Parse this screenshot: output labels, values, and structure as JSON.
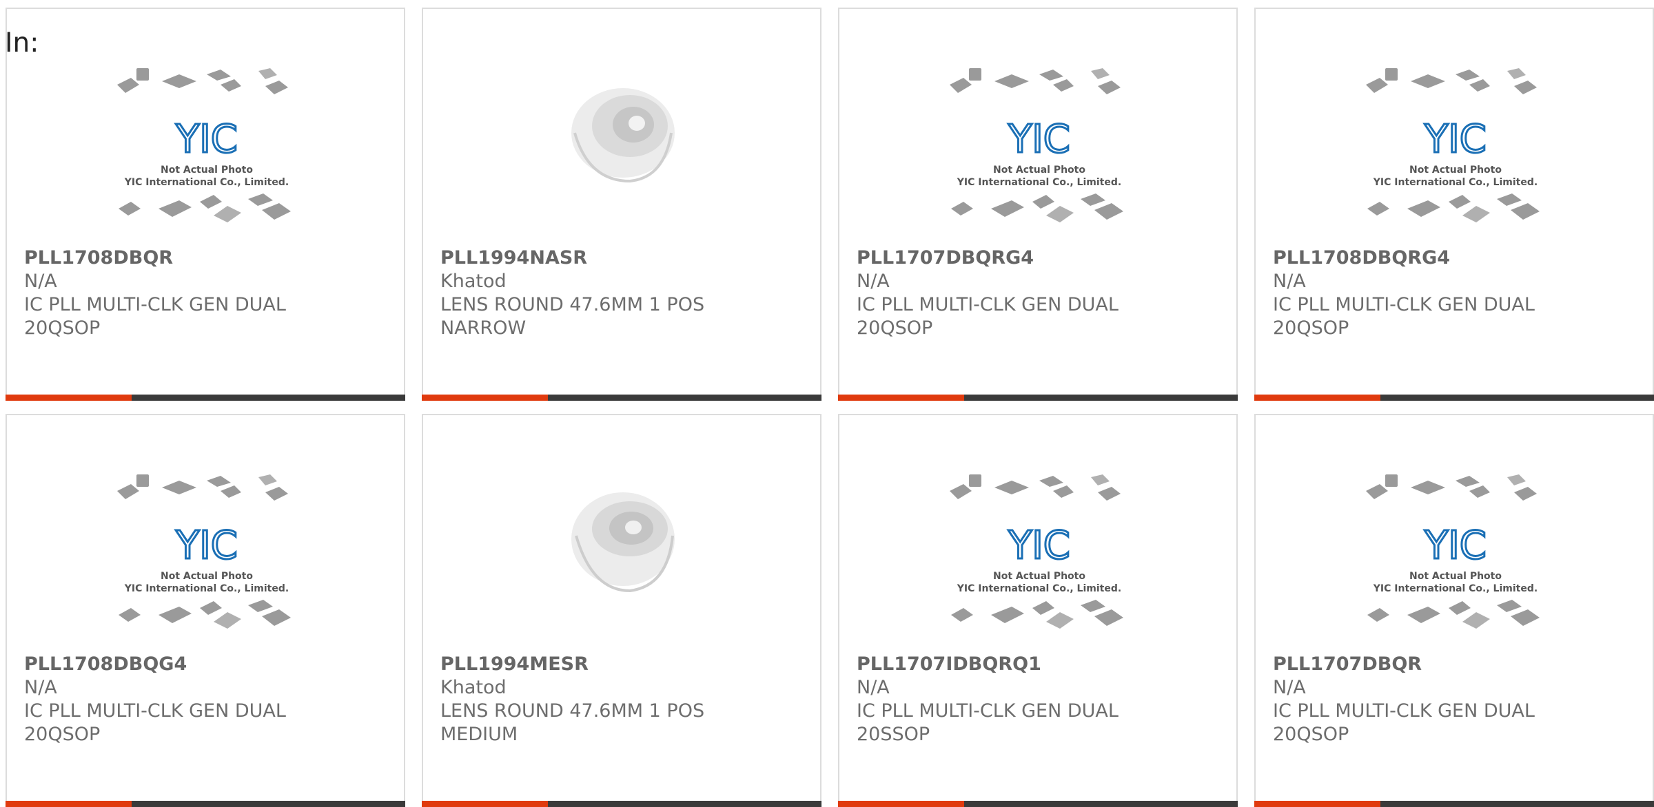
{
  "header": {
    "label": "In:"
  },
  "placeholder": {
    "line1": "Not Actual Photo",
    "line2": "YIC International Co., Limited."
  },
  "products": [
    {
      "part": "PLL1708DBQR",
      "mfr": "N/A",
      "desc": "IC PLL MULTI-CLK GEN DUAL 20QSOP",
      "image": "yic-placeholder"
    },
    {
      "part": "PLL1994NASR",
      "mfr": "Khatod",
      "desc": "LENS ROUND 47.6MM 1 POS NARROW",
      "image": "lens-photo"
    },
    {
      "part": "PLL1707DBQRG4",
      "mfr": "N/A",
      "desc": "IC PLL MULTI-CLK GEN DUAL 20QSOP",
      "image": "yic-placeholder"
    },
    {
      "part": "PLL1708DBQRG4",
      "mfr": "N/A",
      "desc": "IC PLL MULTI-CLK GEN DUAL 20QSOP",
      "image": "yic-placeholder"
    },
    {
      "part": "PLL1708DBQG4",
      "mfr": "N/A",
      "desc": "IC PLL MULTI-CLK GEN DUAL 20QSOP",
      "image": "yic-placeholder"
    },
    {
      "part": "PLL1994MESR",
      "mfr": "Khatod",
      "desc": "LENS ROUND 47.6MM 1 POS MEDIUM",
      "image": "lens-photo"
    },
    {
      "part": "PLL1707IDBQRQ1",
      "mfr": "N/A",
      "desc": "IC PLL MULTI-CLK GEN DUAL 20SSOP",
      "image": "yic-placeholder"
    },
    {
      "part": "PLL1707DBQR",
      "mfr": "N/A",
      "desc": "IC PLL MULTI-CLK GEN DUAL 20QSOP",
      "image": "yic-placeholder"
    }
  ],
  "colors": {
    "accent": "#e03a0e",
    "bar": "#3a3a3a",
    "logo": "#1a6fb5"
  }
}
